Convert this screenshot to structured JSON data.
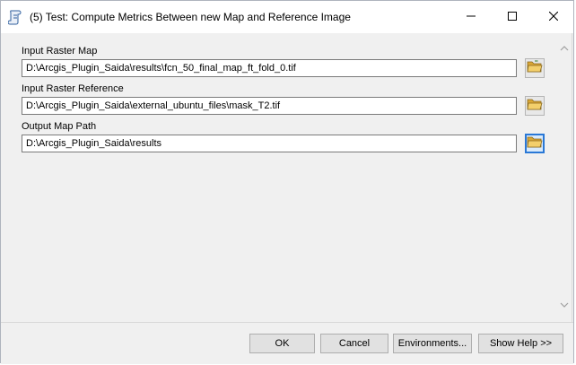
{
  "window": {
    "title": "(5) Test: Compute Metrics Between new Map and Reference Image",
    "app_icon": "script-tool-icon",
    "minimize_icon": "minimize-icon",
    "maximize_icon": "maximize-icon",
    "close_icon": "close-icon"
  },
  "fields": [
    {
      "label": "Input Raster Map",
      "value": "D:\\Arcgis_Plugin_Saida\\results\\fcn_50_final_map_ft_fold_0.tif",
      "browse_icon": "open-folder-icon"
    },
    {
      "label": "Input Raster Reference",
      "value": "D:\\Arcgis_Plugin_Saida\\external_ubuntu_files\\mask_T2.tif",
      "browse_icon": "open-folder-icon"
    },
    {
      "label": "Output Map Path",
      "value": "D:\\Arcgis_Plugin_Saida\\results",
      "browse_icon": "open-folder-icon"
    }
  ],
  "scrollbar": {
    "up_icon": "chevron-up-icon",
    "down_icon": "chevron-down-icon"
  },
  "footer": {
    "ok_label": "OK",
    "cancel_label": "Cancel",
    "environments_label": "Environments...",
    "show_help_label": "Show Help >>"
  },
  "colors": {
    "focus_accent": "#2a78d6",
    "folder_yellow": "#e8b84a"
  }
}
